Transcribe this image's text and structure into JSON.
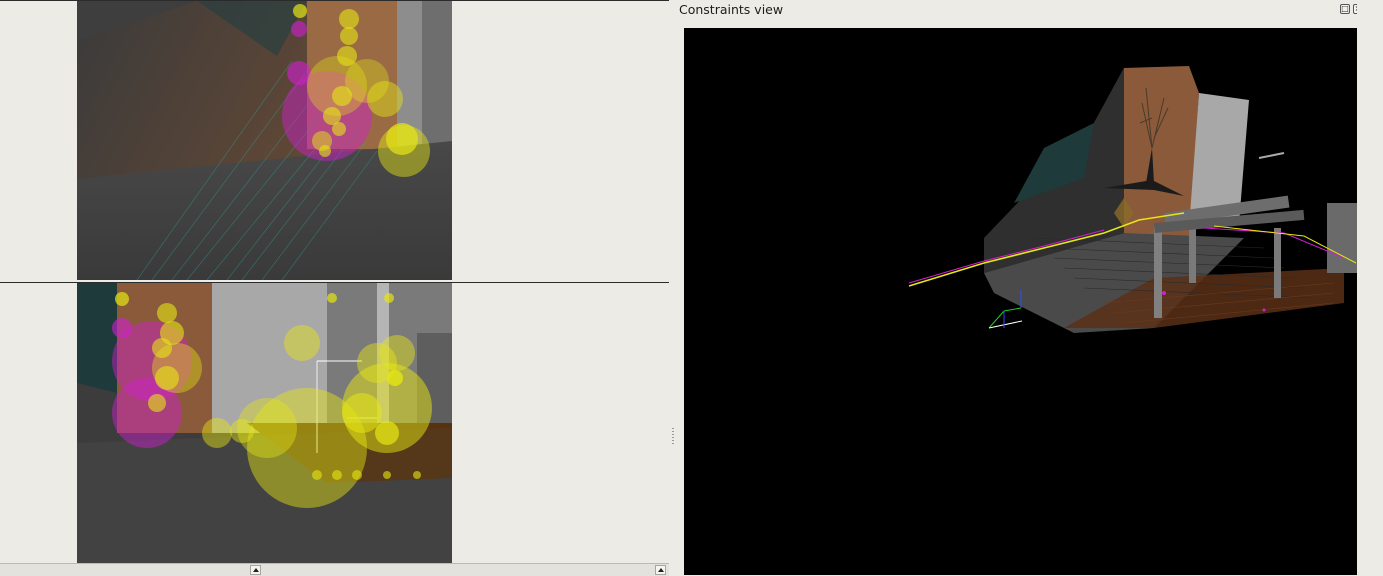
{
  "dock": {
    "title": "Constraints view",
    "float_button_icon": "float-icon",
    "close_button_icon": "close-icon"
  },
  "left_panel": {
    "views": [
      "top-camera-view",
      "bottom-camera-view"
    ],
    "scroll_arrow_icon": "arrow-up-icon"
  },
  "colors": {
    "background": "#edebe6",
    "feature_yellow": "#e6e614",
    "feature_magenta": "#d21ed2",
    "match_line": "#2fa59b",
    "wall_orange": "#8a5a3a",
    "floor": "#3c3c3c"
  }
}
